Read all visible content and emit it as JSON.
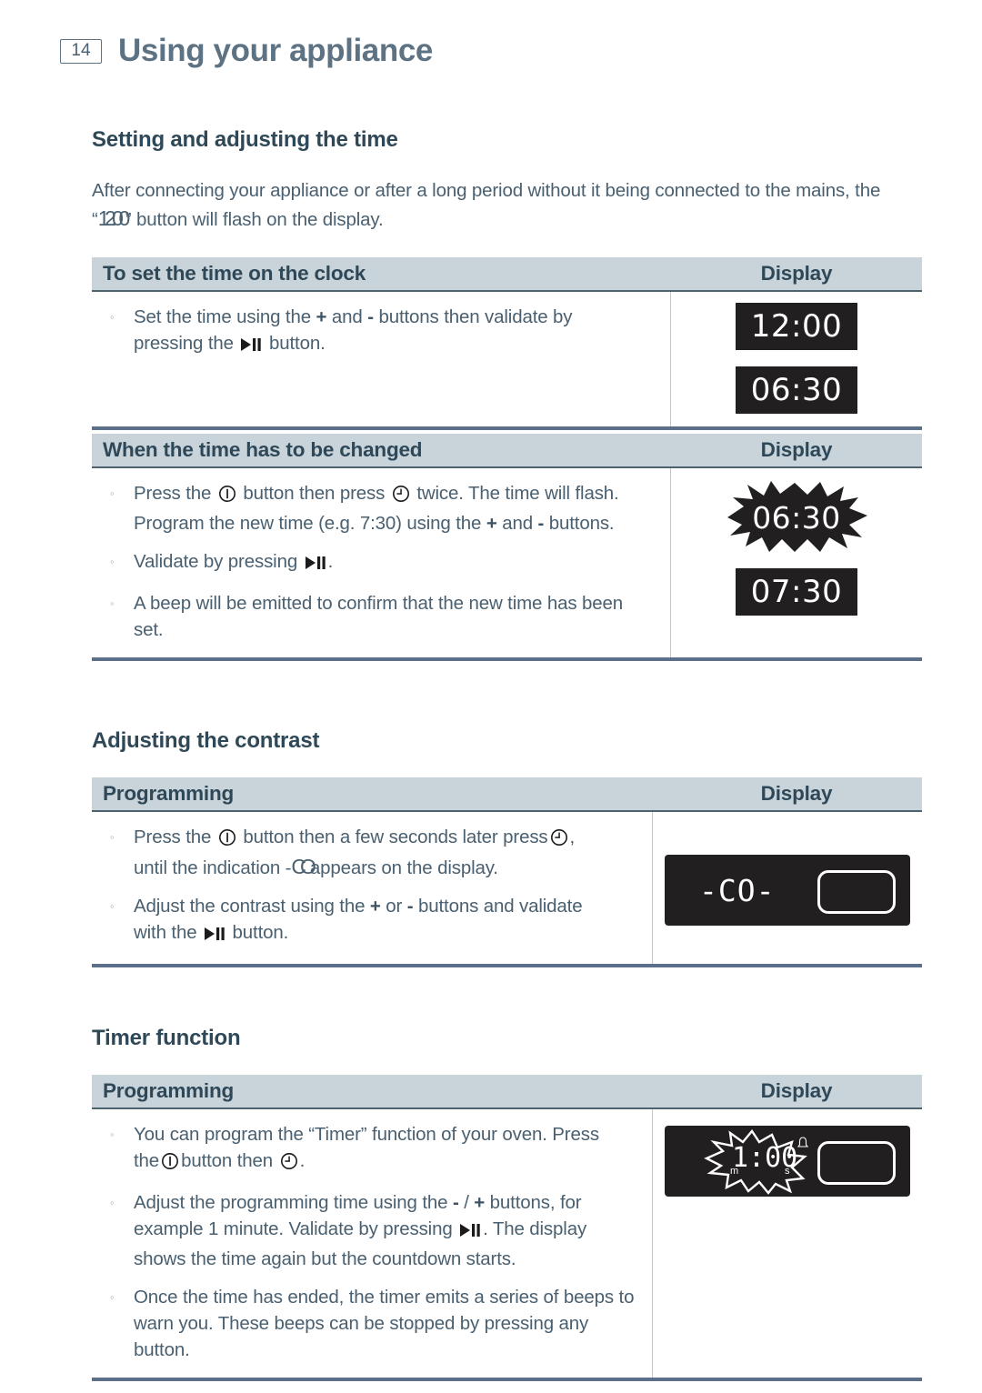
{
  "header": {
    "page_number": "14",
    "title": "Using your appliance"
  },
  "sections": [
    {
      "title": "Setting and adjusting the time",
      "intro_part1": "After connecting your appliance or after a long period without it being connected to the mains, the “",
      "intro_lcd": "12:00",
      "intro_part2": "” button will flash on the display.",
      "tables": [
        {
          "header_left": "To set the time on the clock",
          "header_right": "Display",
          "bullets": [
            {
              "pre": "Set the time using the",
              "sym1": "+",
              "mid1": "and",
              "sym2": "-",
              "mid2": "buttons then validate by pressing the",
              "icon": "play-pause",
              "post": "button."
            }
          ],
          "displays": [
            "12:00",
            "06:30"
          ]
        },
        {
          "header_left": "When the time has to be changed",
          "header_right": "Display",
          "bullets_text": [
            "Press the ⓘ button then press ◴ twice. The time will flash. Program the new time (e.g. 7:30) using the + and - buttons.",
            "Validate by pressing ▶❙❙.",
            "A beep will be emitted to confirm that the new time has been set."
          ],
          "flash_display": "06:30",
          "solid_display": "07:30"
        }
      ]
    },
    {
      "title": "Adjusting the contrast",
      "table": {
        "header_left": "Programming",
        "header_right": "Display",
        "bullets_text": [
          "Press the ⓘ button then a few seconds later press ◴, until the indication -CO- appears on the display.",
          "Adjust the contrast using the + or - buttons and validate with the ▶❙❙ button."
        ],
        "display_code": "-CO-"
      }
    },
    {
      "title": "Timer function",
      "table": {
        "header_left": "Programming",
        "header_right": "Display",
        "bullets_text": [
          "You can program the “Timer” function of your oven. Press the ⓘ button then ◴.",
          "Adjust the programming time using the - / + buttons, for example 1 minute. Validate by pressing ▶❙❙. The display shows the time again but the countdown starts.",
          "Once the time has ended, the timer emits a series of beeps to warn you. These beeps can be stopped by pressing any button."
        ],
        "display_time": "1:00",
        "unit_minutes": "m",
        "unit_seconds": "s"
      }
    }
  ],
  "text_fragments": {
    "t1_b1_a": "Set the time using the",
    "t1_b1_plus": "+",
    "t1_b1_and": "and",
    "t1_b1_minus": "-",
    "t1_b1_b": "buttons then validate by",
    "t1_b1_c": "pressing the",
    "t1_b1_d": "button.",
    "t2_b1_a": "Press the",
    "t2_b1_b": "button then press",
    "t2_b1_c": "twice. The time will flash.",
    "t2_b1_d": "Program the new time (e.g. 7:30) using the",
    "t2_b1_plus": "+",
    "t2_b1_and": "and",
    "t2_b1_minus": "-",
    "t2_b1_e": "buttons.",
    "t2_b2_a": "Validate by pressing",
    "t2_b2_b": ".",
    "t2_b3_a": "A beep will be emitted to confirm that the new time has been set.",
    "t3_b1_a": "Press the",
    "t3_b1_b": "button then a few seconds later press",
    "t3_b1_c": ",",
    "t3_b1_d": "until the indication -",
    "t3_b1_co": "CO",
    "t3_b1_e": "appears on the display.",
    "t3_b2_a": "Adjust the contrast using the",
    "t3_b2_plus": "+",
    "t3_b2_or": "or",
    "t3_b2_minus": "-",
    "t3_b2_b": "buttons and validate",
    "t3_b2_c": "with the",
    "t3_b2_d": "button.",
    "t4_b1_a": "You can program the “Timer” function of your oven. Press",
    "t4_b1_b": "the",
    "t4_b1_c": "button then",
    "t4_b1_d": ".",
    "t4_b2_a": "Adjust the programming time using the",
    "t4_b2_minus": "-",
    "t4_b2_slash": "/",
    "t4_b2_plus": "+",
    "t4_b2_b": "buttons, for",
    "t4_b2_c": "example 1 minute. Validate by pressing",
    "t4_b2_d": ". The display",
    "t4_b2_e": "shows the time again but the countdown starts.",
    "t4_b3_a": "Once the time has ended, the timer emits a series of beeps to warn you. These beeps can be stopped by pressing any button."
  },
  "bullet_marker": "◦",
  "colors": {
    "title": "#5d7384",
    "body_text": "#4a6070",
    "table_header_bg": "#c8d3da",
    "table_header_border": "#4d6470",
    "table_bottom_rule": "#5b6f8b",
    "lcd_bg": "#221f20"
  }
}
